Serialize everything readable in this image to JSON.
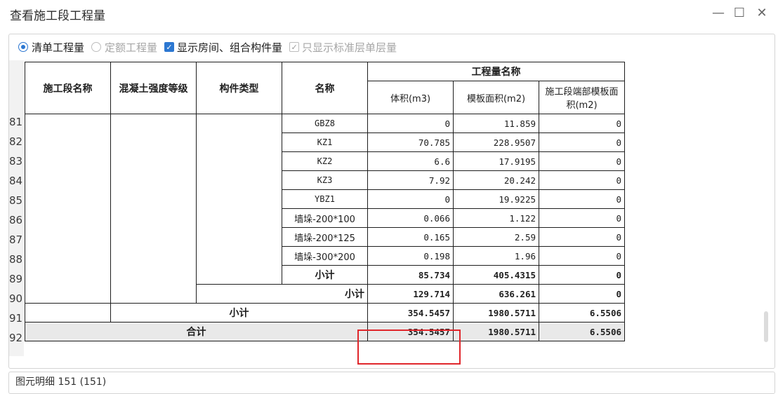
{
  "window": {
    "title": "查看施工段工程量",
    "minimize": "—",
    "maximize": "☐",
    "close": "✕"
  },
  "options": {
    "radio1": "清单工程量",
    "radio2": "定额工程量",
    "check1": "显示房间、组合构件量",
    "check2": "只显示标准层单层量"
  },
  "headers": {
    "section": "施工段名称",
    "concrete": "混凝土强度等级",
    "type": "构件类型",
    "name": "名称",
    "qty_group": "工程量名称",
    "volume": "体积(m3)",
    "formwork": "模板面积(m2)",
    "end_formwork": "施工段端部模板面积(m2)"
  },
  "row_numbers": [
    "81",
    "82",
    "83",
    "84",
    "85",
    "86",
    "87",
    "88",
    "89",
    "90",
    "91",
    "92"
  ],
  "rows": [
    {
      "name": "GBZ8",
      "vol": "0",
      "form": "11.859",
      "end": "0"
    },
    {
      "name": "KZ1",
      "vol": "70.785",
      "form": "228.9507",
      "end": "0"
    },
    {
      "name": "KZ2",
      "vol": "6.6",
      "form": "17.9195",
      "end": "0"
    },
    {
      "name": "KZ3",
      "vol": "7.92",
      "form": "20.242",
      "end": "0"
    },
    {
      "name": "YBZ1",
      "vol": "0",
      "form": "19.9225",
      "end": "0"
    },
    {
      "name": "墙垛-200*100",
      "vol": "0.066",
      "form": "1.122",
      "end": "0"
    },
    {
      "name": "墙垛-200*125",
      "vol": "0.165",
      "form": "2.59",
      "end": "0"
    },
    {
      "name": "墙垛-300*200",
      "vol": "0.198",
      "form": "1.96",
      "end": "0"
    }
  ],
  "subtotals": [
    {
      "label": "小计",
      "vol": "85.734",
      "form": "405.4315",
      "end": "0"
    },
    {
      "label": "小计",
      "vol": "129.714",
      "form": "636.261",
      "end": "0"
    },
    {
      "label": "小计",
      "vol": "354.5457",
      "form": "1980.5711",
      "end": "6.5506"
    }
  ],
  "total": {
    "label": "合计",
    "vol": "354.5457",
    "form": "1980.5711",
    "end": "6.5506"
  },
  "bottom": {
    "text": "图元明细 151 (151)"
  }
}
